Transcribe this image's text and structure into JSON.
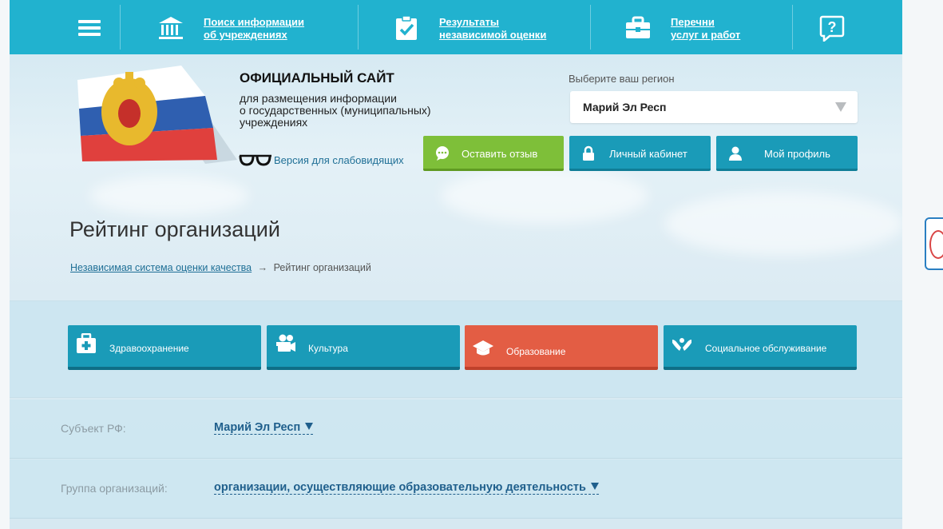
{
  "topbar": {
    "nav": [
      {
        "label": "Поиск информации\nоб учреждениях",
        "icon": "institution-icon"
      },
      {
        "label": "Результаты\nнезависимой оценки",
        "icon": "checklist-icon"
      },
      {
        "label": "Перечни\nуслуг и работ",
        "icon": "briefcase-icon"
      }
    ],
    "menu_icon": "hamburger-menu-icon",
    "help_icon": "help-question-icon"
  },
  "header": {
    "title": "ОФИЦИАЛЬНЫЙ САЙТ",
    "subtitle": "для размещения информации\nо государственных (муниципальных)\nучреждениях",
    "low_vision_link": "Версия для слабовидящих",
    "region_label": "Выберите ваш регион",
    "region_value": "Марий Эл Респ"
  },
  "actions": {
    "review": "Оставить отзыв",
    "cabinet": "Личный кабинет",
    "profile": "Мой профиль"
  },
  "page": {
    "title": "Рейтинг организаций",
    "breadcrumb_link": "Независимая система оценки качества",
    "breadcrumb_arrow": "→",
    "breadcrumb_current": "Рейтинг организаций"
  },
  "categories": [
    {
      "label": "Здравоохранение",
      "icon": "medkit-icon",
      "active": false
    },
    {
      "label": "Культура",
      "icon": "film-camera-icon",
      "active": false
    },
    {
      "label": "Образование",
      "icon": "graduation-cap-icon",
      "active": true
    },
    {
      "label": "Социальное обслуживание",
      "icon": "caring-hands-icon",
      "active": false
    }
  ],
  "filters": {
    "subject_label": "Субъект РФ:",
    "subject_value": "Марий Эл Респ",
    "group_label": "Группа организаций:",
    "group_value": "организации, осуществляющие образовательную деятельность"
  },
  "colors": {
    "topbar": "#21b2cf",
    "primary_button": "#1a9bb8",
    "review_button": "#7ebf39",
    "active_category": "#e35d44"
  }
}
